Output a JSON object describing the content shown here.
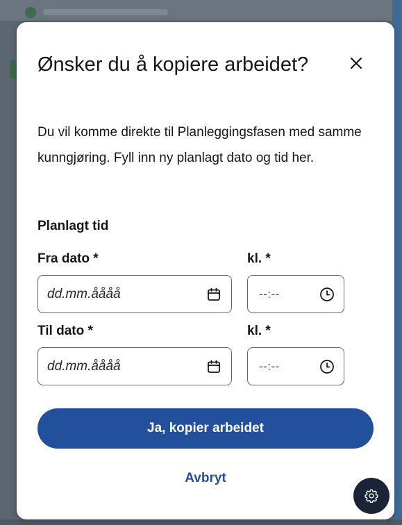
{
  "dialog": {
    "title": "Ønsker du å kopiere arbeidet?",
    "close_icon": "close-icon",
    "description": "Du vil komme direkte til Planleggingsfasen med samme kunngjøring. Fyll inn ny planlagt dato og tid her.",
    "section_heading": "Planlagt tid",
    "from": {
      "date_label": "Fra dato *",
      "date_placeholder": "dd.mm.åååå",
      "time_label": "kl. *",
      "time_placeholder": "--:--"
    },
    "to": {
      "date_label": "Til dato *",
      "date_placeholder": "dd.mm.åååå",
      "time_label": "kl. *",
      "time_placeholder": "--:--"
    },
    "confirm_label": "Ja, kopier arbeidet",
    "cancel_label": "Avbryt"
  },
  "icons": {
    "date": "calendar-icon",
    "time": "clock-icon",
    "settings": "gear-icon"
  },
  "colors": {
    "accent": "#23509c",
    "text": "#14171a",
    "settings_fab": "#1b2437"
  }
}
